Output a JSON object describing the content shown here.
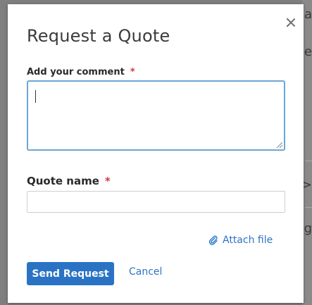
{
  "background": {
    "glyphs": [
      "a",
      "e",
      ">",
      "g"
    ]
  },
  "dialog": {
    "title": "Request a Quote",
    "comment_label": "Add your comment",
    "comment_required": "*",
    "comment_value": "",
    "name_label": "Quote name",
    "name_required": "*",
    "name_value": "",
    "attach_label": "Attach file",
    "send_label": "Send Request",
    "cancel_label": "Cancel"
  },
  "colors": {
    "accent": "#2a73c4",
    "required": "#d7373f",
    "focus_border": "#6ba6d8"
  },
  "icons": {
    "close": "close-icon",
    "attach": "paperclip-icon"
  }
}
